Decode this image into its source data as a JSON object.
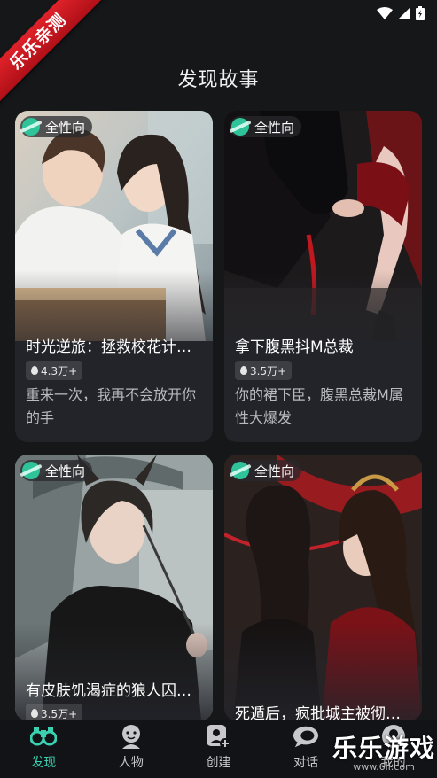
{
  "ribbon": {
    "text": "乐乐亲测"
  },
  "page": {
    "title": "发现故事"
  },
  "cards": [
    {
      "tag": "全性向",
      "title": "时光逆旅：拯救校花计…",
      "heat": "4.3万+",
      "desc": "重来一次，我再不会放开你的手"
    },
    {
      "tag": "全性向",
      "title": "拿下腹黑抖M总裁",
      "heat": "3.5万+",
      "desc": "你的裙下臣，腹黑总裁M属性大爆发"
    },
    {
      "tag": "全性向",
      "title": "有皮肤饥渴症的狼人囚…",
      "heat": "3.5万+",
      "desc": ""
    },
    {
      "tag": "全性向",
      "title": "死遁后，疯批城主被彻…",
      "heat": "",
      "desc": ""
    }
  ],
  "tabbar": {
    "items": [
      {
        "label": "发现",
        "icon": "binoculars-icon",
        "active": true
      },
      {
        "label": "人物",
        "icon": "person-icon"
      },
      {
        "label": "创建",
        "icon": "create-icon"
      },
      {
        "label": "对话",
        "icon": "chat-icon"
      },
      {
        "label": "我的",
        "icon": "profile-icon"
      }
    ]
  },
  "watermark": {
    "text": "乐乐游戏",
    "sub": "www.6ll.com"
  },
  "colors": {
    "accent": "#3ad1b0",
    "background": "#161719",
    "ribbon": "#d01a22"
  }
}
